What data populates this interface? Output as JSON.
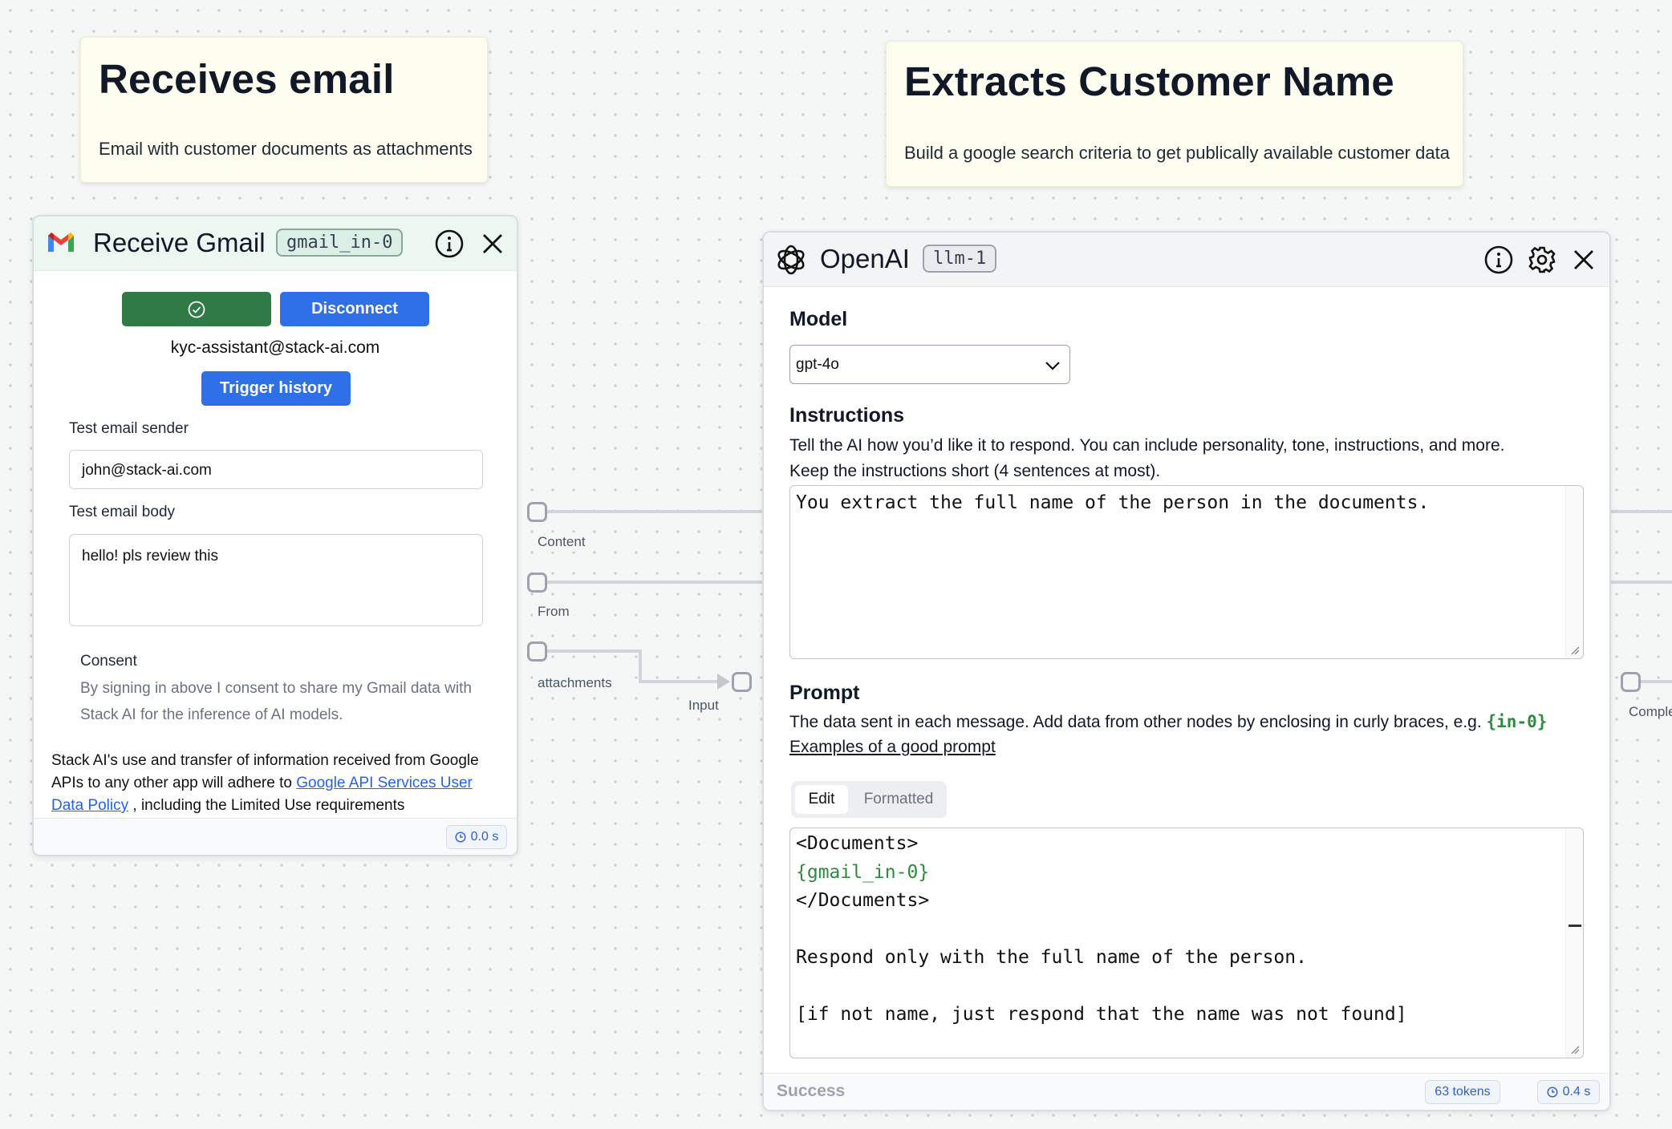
{
  "notes": {
    "receives": {
      "title": "Receives email",
      "body": "Email with customer documents as attachments"
    },
    "extracts": {
      "title": "Extracts Customer Name",
      "body": "Build a google search criteria to get publically available customer data"
    }
  },
  "handles": {
    "content": "Content",
    "from": "From",
    "attachments": "attachments",
    "input": "Input",
    "completion": "Comple"
  },
  "gmail_node": {
    "title": "Receive Gmail",
    "id_chip": "gmail_in-0",
    "disconnect_label": "Disconnect",
    "account": "kyc-assistant@stack-ai.com",
    "trigger_history_label": "Trigger history",
    "sender_label": "Test email sender",
    "sender_value": "john@stack-ai.com",
    "body_label": "Test email body",
    "body_value": "hello! pls review this",
    "consent_title": "Consent",
    "consent_line1": "By signing in above I consent to share my Gmail data with",
    "consent_line2": "Stack AI for the inference of AI models.",
    "policy_line1": "Stack AI's use and transfer of information received from Google",
    "policy_line2_pre": "APIs to any other app will adhere to ",
    "policy_link_a": "Google API Services User",
    "policy_link_b": "Data Policy",
    "policy_line3_post": " , including the Limited Use requirements",
    "time_badge": "0.0 s"
  },
  "openai_node": {
    "title": "OpenAI",
    "id_chip": "llm-1",
    "model_label": "Model",
    "model_value": "gpt-4o",
    "instructions_label": "Instructions",
    "instructions_desc1": "Tell the AI how you’d like it to respond. You can include personality, tone, instructions, and more.",
    "instructions_desc2": "Keep the instructions short (4 sentences at most).",
    "instructions_value": "You extract the full name of the person in the documents.",
    "prompt_label": "Prompt",
    "prompt_desc": "The data sent in each message. Add data from other nodes by enclosing in curly braces, e.g. ",
    "prompt_desc_token": "{in-0}",
    "prompt_link": "Examples of a good prompt",
    "tab_edit": "Edit",
    "tab_formatted": "Formatted",
    "prompt_lines": {
      "l1": "<Documents>",
      "l2": "{gmail_in-0}",
      "l3": "</Documents>",
      "l4": "Respond only with the full name of the person.",
      "l5": "[if not name, just respond that the name was not found]"
    },
    "status": "Success",
    "tokens_badge": "63 tokens",
    "time_badge": "0.4 s"
  },
  "colors": {
    "gmail_header_bg": "#ecf7f2",
    "connected_green": "#2f7a47",
    "primary_blue": "#2f6fe8",
    "token_green": "#2e8b3e"
  }
}
